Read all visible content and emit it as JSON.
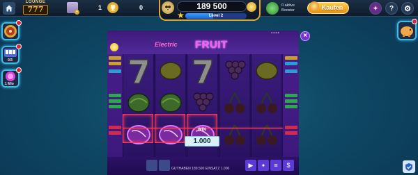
{
  "topbar": {
    "lounge_label": "LOUNGE",
    "lounge_sevens": "777",
    "avatar_badge": "+",
    "player_level": "1",
    "trophy_score": "0",
    "balance": "189 500",
    "level_label": "Level 2",
    "level_progress": 0.45,
    "booster_text": "0 aktive Booster",
    "buy_label": "Kaufen"
  },
  "side": {
    "btn2_text": "0/3",
    "btn3_text": "1 Mio"
  },
  "game": {
    "logo_electric": "Electric",
    "logo_fruit": "FRUIT",
    "reels": [
      [
        "seven",
        "melon",
        "plum"
      ],
      [
        "lemon",
        "melon",
        "plum"
      ],
      [
        "seven",
        "grapes",
        "plum"
      ],
      [
        "grapes",
        "cherry",
        "cherry"
      ],
      [
        "lemon",
        "cherry",
        "cherry"
      ]
    ],
    "win_label": "WIN",
    "win_amount": "1.000",
    "info": "GUTHABEN 189.500   EINSATZ 1.000"
  },
  "colors": {
    "accent": "#ff3b5c",
    "gold": "#f6c23c",
    "purple": "#3a177a"
  }
}
